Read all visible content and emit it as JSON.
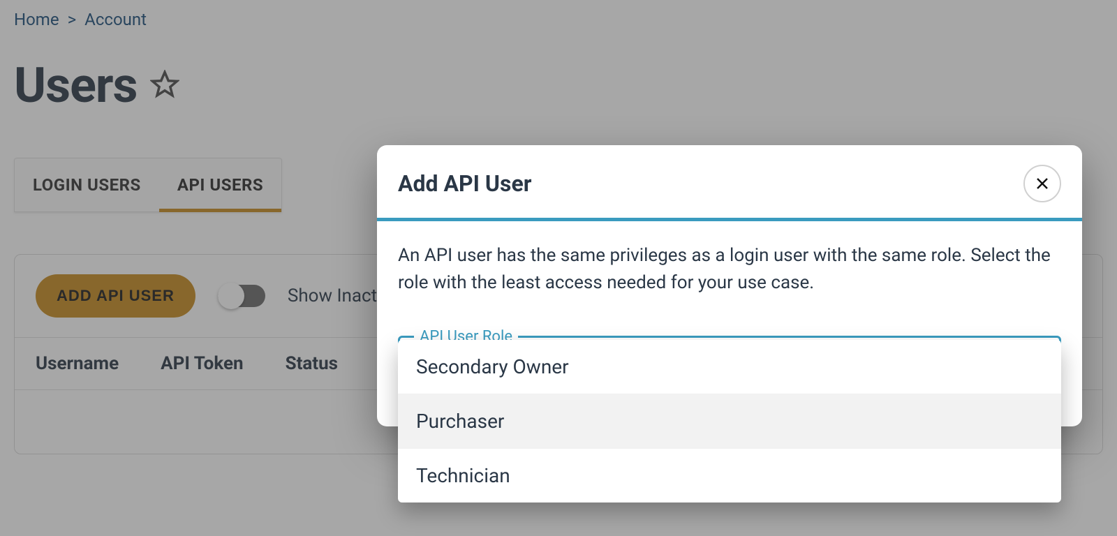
{
  "breadcrumbs": {
    "home": "Home",
    "account": "Account"
  },
  "page": {
    "title": "Users"
  },
  "tabs": {
    "login_users": "LOGIN USERS",
    "api_users": "API USERS"
  },
  "toolbar": {
    "add_api_user": "ADD API USER",
    "show_inactive": "Show Inactive"
  },
  "table": {
    "col_username": "Username",
    "col_api_token": "API Token",
    "col_status": "Status"
  },
  "modal": {
    "title": "Add API User",
    "description": "An API user has the same privileges as a login user with the same role. Select the role with the least access needed for your use case.",
    "field_label": "API User Role",
    "options": {
      "secondary_owner": "Secondary Owner",
      "purchaser": "Purchaser",
      "technician": "Technician"
    }
  }
}
